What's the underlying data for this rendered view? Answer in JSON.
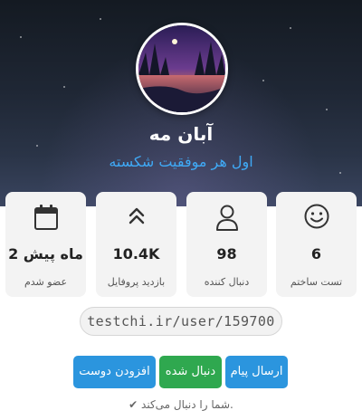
{
  "profile": {
    "name": "آبان مه",
    "bio": "اول هر موفقیت شکسته",
    "url": "testchi.ir/user/159700"
  },
  "stats": [
    {
      "value": "6",
      "label": "تست ساختم",
      "icon": "smile-icon"
    },
    {
      "value": "98",
      "label": "دنبال کننده",
      "icon": "user-icon"
    },
    {
      "value": "10.4K",
      "label": "بازدید پروفایل",
      "icon": "chevrons-up-icon"
    },
    {
      "value": "2 ماه پیش",
      "label": "عضو شدم",
      "icon": "calendar-icon"
    }
  ],
  "actions": {
    "send_message": "ارسال پیام",
    "following": "دنبال شده",
    "add_friend": "افزودن دوست"
  },
  "follow_note": "✔ شما را دنبال می‌کند.",
  "colors": {
    "accent_blue": "#2b95de",
    "accent_green": "#2fa84f",
    "bio_blue": "#3fa9f5"
  }
}
